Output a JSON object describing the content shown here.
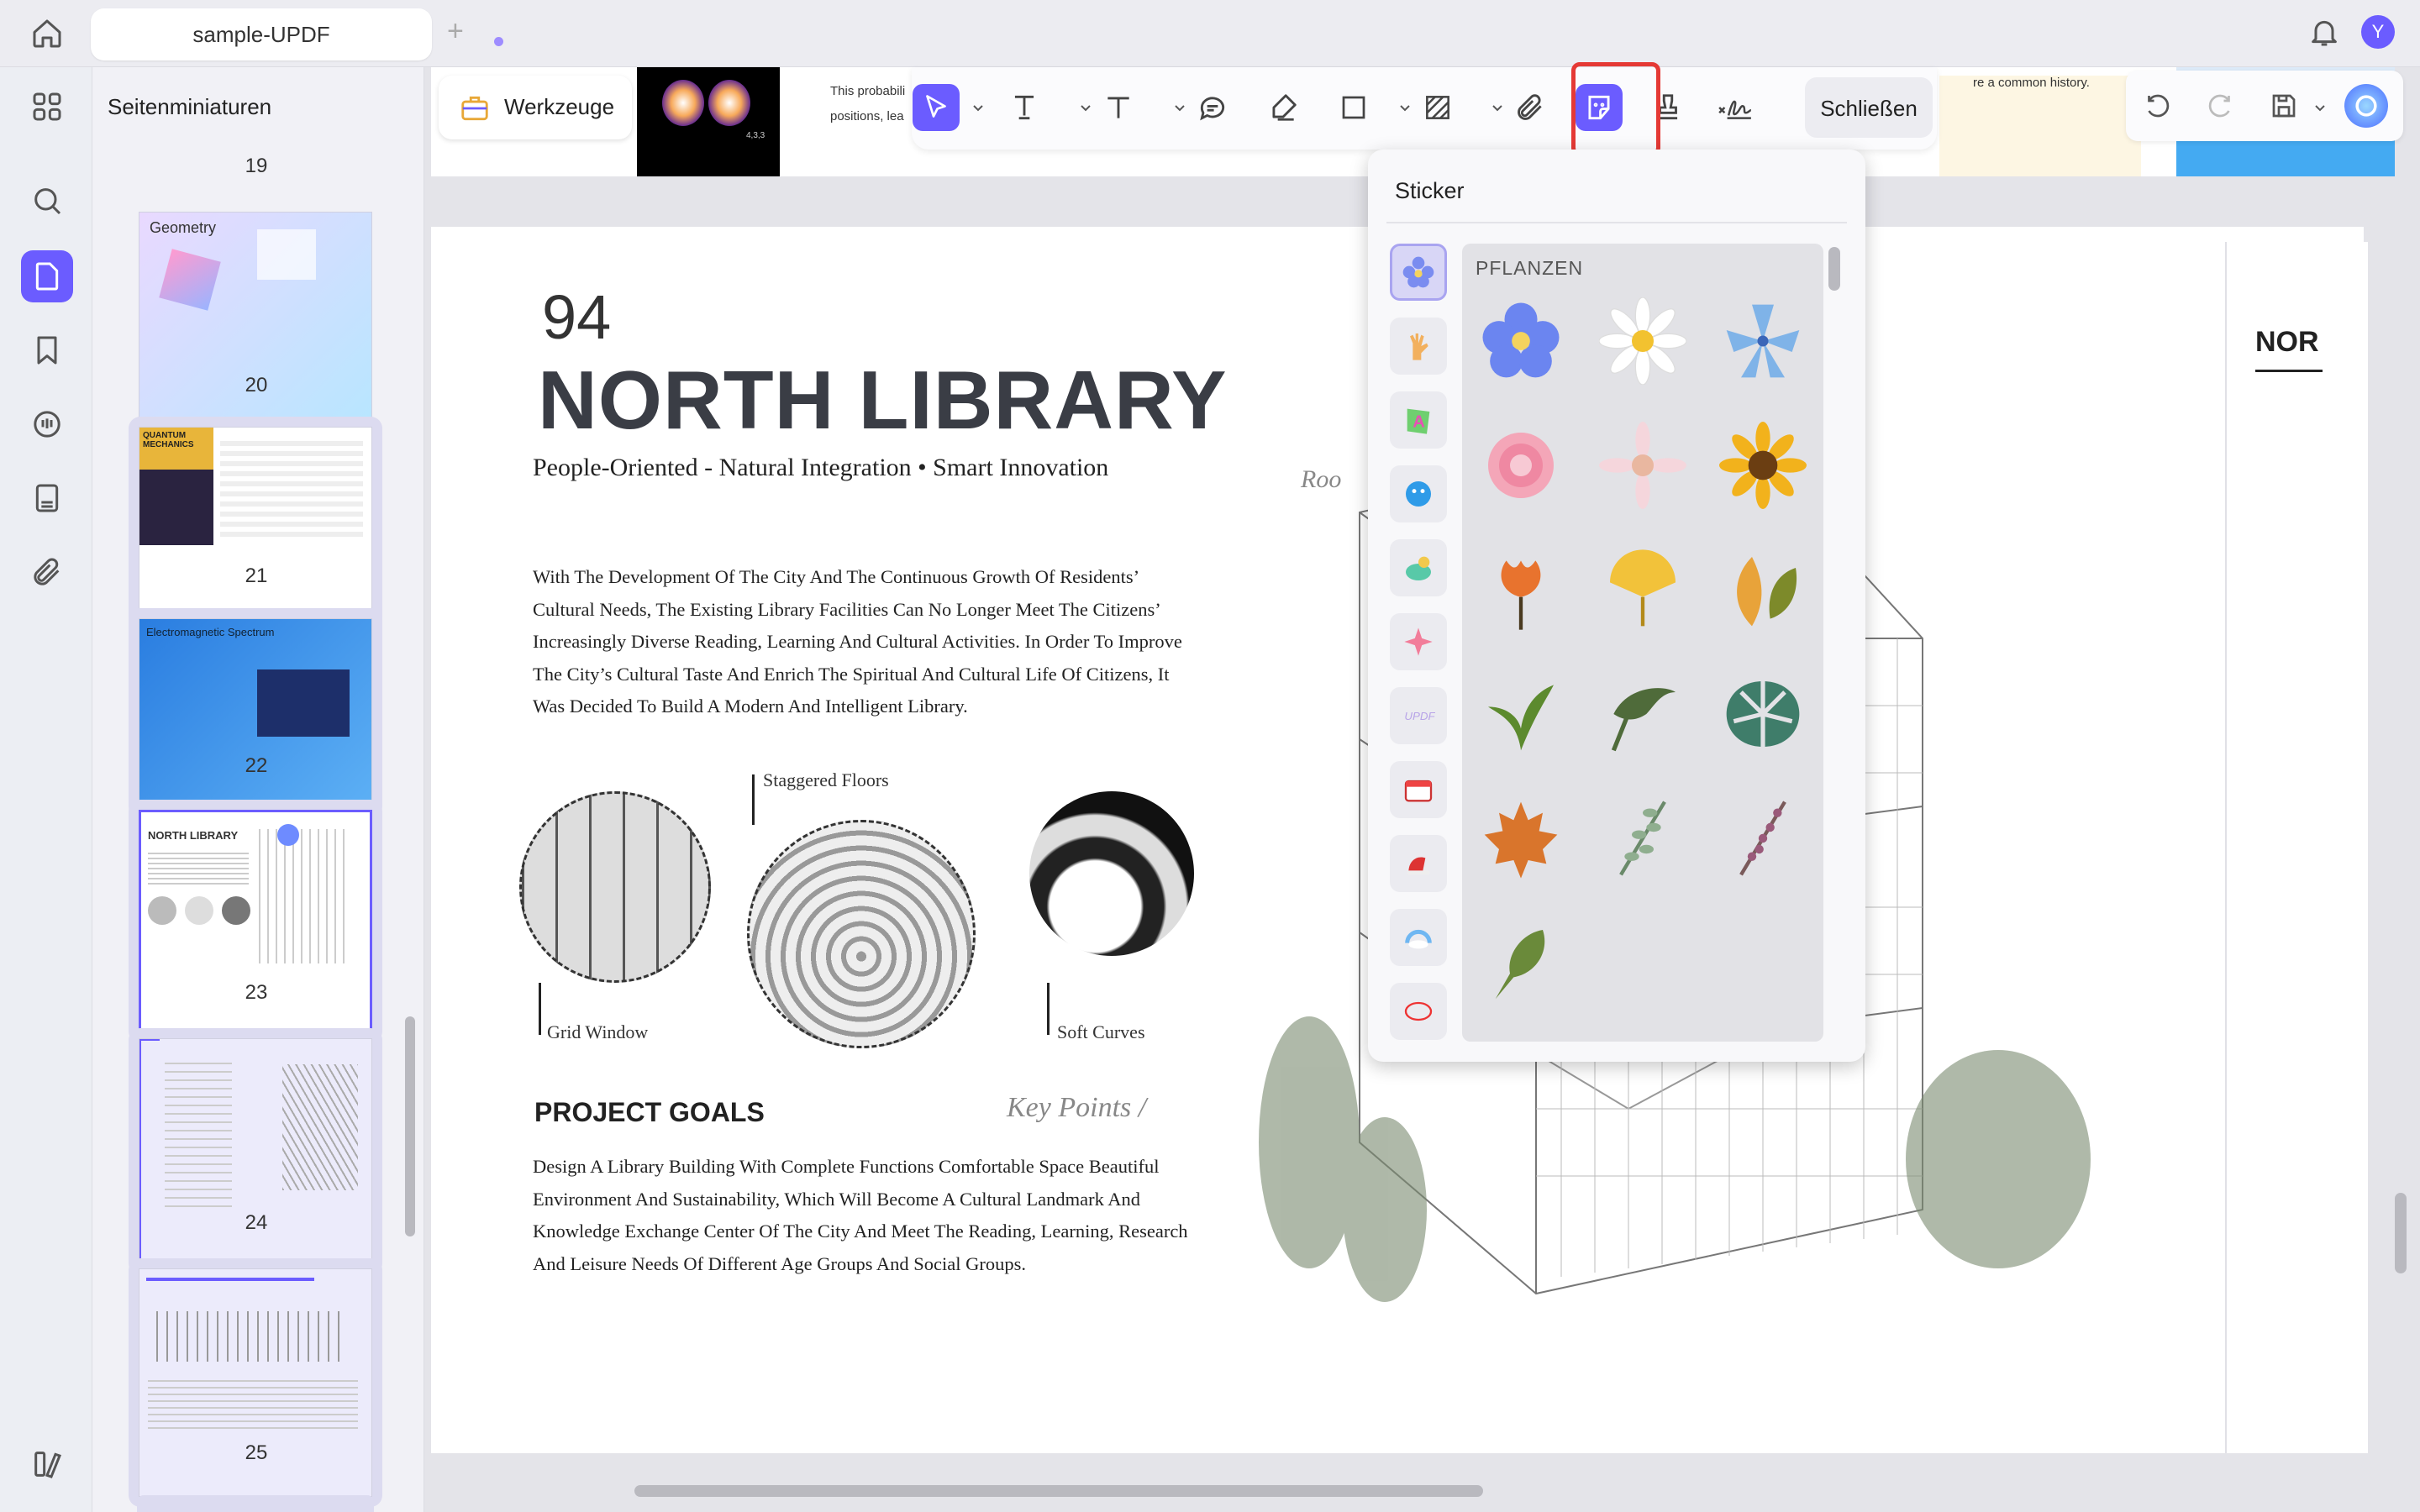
{
  "tab": {
    "title": "sample-UPDF",
    "add_label": "+"
  },
  "user": {
    "avatar_letter": "Y"
  },
  "thumbnails": {
    "title": "Seitenminiaturen",
    "page_numbers": [
      "19",
      "20",
      "21",
      "22",
      "23",
      "24",
      "25"
    ],
    "items": [
      {
        "page": "20",
        "label": "Geometry"
      },
      {
        "page": "21",
        "label": "QUANTUM MECHANICS"
      },
      {
        "page": "22",
        "label": "Electromagnetic Spectrum"
      },
      {
        "page": "23",
        "label": "NORTH LIBRARY",
        "selected": true
      },
      {
        "page": "24",
        "label": ""
      },
      {
        "page": "25",
        "label": ""
      }
    ]
  },
  "toolbar": {
    "werkzeuge_label": "Werkzeuge",
    "close_label": "Schließen",
    "tools": [
      "select-icon",
      "text-icon",
      "textbox-icon",
      "comment-icon",
      "highlight-icon",
      "rectangle-icon",
      "area-icon",
      "attachment-icon",
      "sticker-icon",
      "stamp-icon",
      "signature-icon"
    ],
    "active_tool": "sticker-icon"
  },
  "peek_text": {
    "left1": "This probabili",
    "left2": "positions, lea",
    "right": "re a common history.",
    "right_page_heading": "NOR",
    "fig_label": "4,3,3"
  },
  "document": {
    "number": "94",
    "title": "NORTH LIBRARY",
    "subtitle": "People-Oriented - Natural Integration • Smart Innovation",
    "body": "With The Development Of The City And The Continuous Growth Of Residents’ Cultural Needs, The Existing Library Facilities Can No Longer Meet The Citizens’ Increasingly Diverse Reading, Learning And Cultural Activities. In Order To Improve The City’s Cultural Taste And Enrich The Spiritual And Cultural Life Of Citizens, It Was Decided To Build A Modern And Intelligent Library.",
    "captions": {
      "staggered": "Staggered Floors",
      "grid": "Grid Window",
      "soft": "Soft Curves"
    },
    "goals_title": "PROJECT GOALS",
    "key_points": "Key Points /",
    "goals_body": "Design A Library Building With Complete Functions Comfortable Space Beautiful Environment And Sustainability, Which Will Become A Cultural Landmark And Knowledge Exchange Center Of The City And Meet The Reading, Learning, Research And Leisure Needs Of Different Age Groups And Social Groups.",
    "sketch_text": "Roo"
  },
  "sticker_popup": {
    "title": "Sticker",
    "category_label": "PFLANZEN",
    "categories": [
      "plants-icon",
      "hand-icon",
      "letter-icon",
      "emoji-icon",
      "animal-icon",
      "sparkle-icon",
      "updf-icon",
      "calendar-icon",
      "holiday-icon",
      "weather-icon",
      "shape-icon"
    ],
    "stickers": [
      "blue-flower",
      "white-daisy",
      "blue-lily",
      "pink-rose",
      "pink-daisy",
      "sunflower",
      "orange-flower",
      "ginkgo-leaf",
      "autumn-leaves",
      "green-leaf",
      "palm-leaf",
      "monstera-leaf",
      "maple-leaf",
      "eucalyptus",
      "lavender-sprig",
      "single-leaf"
    ]
  },
  "colors": {
    "accent": "#6b5cff",
    "highlight_frame": "#e53935"
  }
}
